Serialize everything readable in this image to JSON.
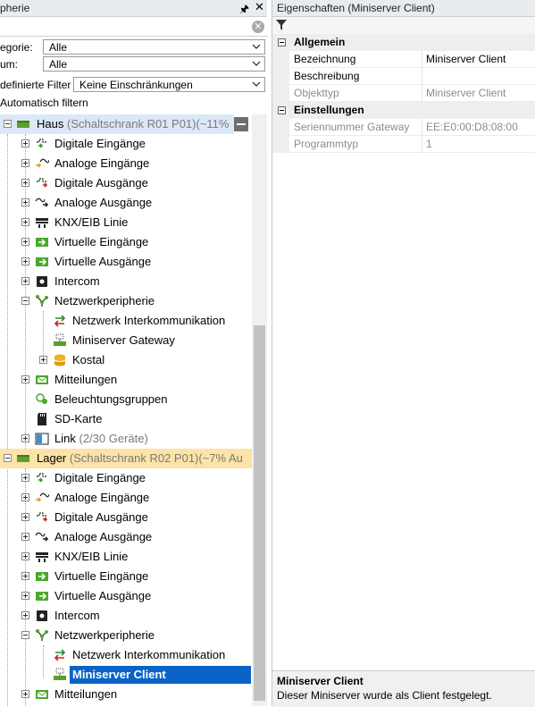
{
  "left_panel": {
    "title": "pherie",
    "pin_glyph": "↑",
    "close_glyph": "✕",
    "filters": [
      {
        "label": "egorie:",
        "value": "Alle"
      },
      {
        "label": "um:",
        "value": "Alle"
      },
      {
        "label": "definierte Filter",
        "value": "Keine Einschränkungen"
      }
    ],
    "auto_filter_label": "Automatisch filtern",
    "tree": {
      "haus": {
        "name": "Haus",
        "detail": "(Schaltschrank R01 P01)(~11%"
      },
      "haus_children": [
        {
          "label": "Digitale Eingänge",
          "icon": "digital-input-icon"
        },
        {
          "label": "Analoge Eingänge",
          "icon": "analog-input-icon"
        },
        {
          "label": "Digitale Ausgänge",
          "icon": "digital-output-icon"
        },
        {
          "label": "Analoge Ausgänge",
          "icon": "analog-output-icon"
        },
        {
          "label": "KNX/EIB Linie",
          "icon": "knx-icon"
        },
        {
          "label": "Virtuelle Eingänge",
          "icon": "virtual-input-icon"
        },
        {
          "label": "Virtuelle Ausgänge",
          "icon": "virtual-output-icon"
        },
        {
          "label": "Intercom",
          "icon": "intercom-icon"
        },
        {
          "label": "Netzwerkperipherie",
          "icon": "network-icon"
        }
      ],
      "haus_network_children": [
        {
          "label": "Netzwerk Interkommunikation",
          "icon": "intercommunication-icon"
        },
        {
          "label": "Miniserver Gateway",
          "icon": "miniserver-icon"
        },
        {
          "label": "Kostal",
          "icon": "database-icon"
        }
      ],
      "haus_tail": [
        {
          "label": "Mitteilungen",
          "icon": "messages-icon"
        },
        {
          "label": "Beleuchtungsgruppen",
          "icon": "lighting-group-icon"
        },
        {
          "label": "SD-Karte",
          "icon": "sd-card-icon"
        }
      ],
      "haus_link": {
        "label": "Link",
        "detail": "(2/30 Geräte)"
      },
      "lager": {
        "name": "Lager",
        "detail": "(Schaltschrank R02 P01)(~7% Au"
      },
      "lager_children": [
        {
          "label": "Digitale Eingänge",
          "icon": "digital-input-icon"
        },
        {
          "label": "Analoge Eingänge",
          "icon": "analog-input-icon"
        },
        {
          "label": "Digitale Ausgänge",
          "icon": "digital-output-icon"
        },
        {
          "label": "Analoge Ausgänge",
          "icon": "analog-output-icon"
        },
        {
          "label": "KNX/EIB Linie",
          "icon": "knx-icon"
        },
        {
          "label": "Virtuelle Eingänge",
          "icon": "virtual-input-icon"
        },
        {
          "label": "Virtuelle Ausgänge",
          "icon": "virtual-output-icon"
        },
        {
          "label": "Intercom",
          "icon": "intercom-icon"
        },
        {
          "label": "Netzwerkperipherie",
          "icon": "network-icon"
        }
      ],
      "lager_network_children": [
        {
          "label": "Netzwerk Interkommunikation",
          "icon": "intercommunication-icon"
        },
        {
          "label": "Miniserver Client",
          "icon": "miniserver-icon",
          "selected": true
        }
      ],
      "lager_tail": [
        {
          "label": "Mitteilungen",
          "icon": "messages-icon"
        }
      ]
    }
  },
  "right_panel": {
    "title": "Eigenschaften (Miniserver Client)",
    "categories": [
      {
        "name": "Allgemein",
        "rows": [
          {
            "name": "Bezeichnung",
            "value": "Miniserver Client",
            "readonly": false
          },
          {
            "name": "Beschreibung",
            "value": "",
            "readonly": false
          },
          {
            "name": "Objekttyp",
            "value": "Miniserver Client",
            "readonly": true
          }
        ]
      },
      {
        "name": "Einstellungen",
        "rows": [
          {
            "name": "Seriennummer Gateway",
            "value": "EE:E0:00:D8:08:00",
            "readonly": true
          },
          {
            "name": "Programmtyp",
            "value": "1",
            "readonly": true
          }
        ]
      }
    ],
    "description": {
      "title": "Miniserver Client",
      "text": "Dieser Miniserver wurde als Client festgelegt."
    }
  },
  "colors": {
    "selection": "#0a64c8",
    "haus_highlight": "#dbe8f7",
    "lager_highlight": "#fde3a7",
    "miniserver_green": "#5aa02c"
  }
}
